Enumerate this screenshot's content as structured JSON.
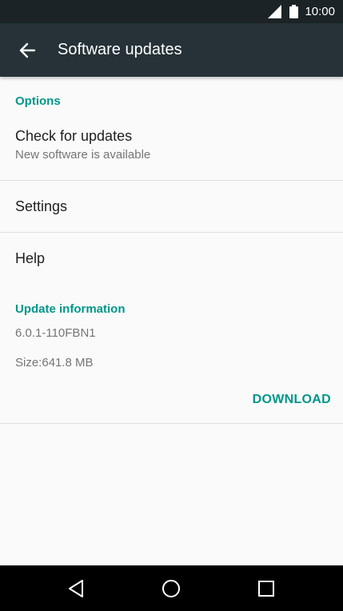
{
  "status_bar": {
    "time": "10:00",
    "icons": [
      "signal-icon",
      "battery-icon"
    ]
  },
  "app_bar": {
    "title": "Software updates",
    "back_icon": "arrow-left-icon"
  },
  "sections": {
    "options_header": "Options",
    "check_updates": {
      "title": "Check for updates",
      "subtitle": "New software is available"
    },
    "settings": {
      "title": "Settings"
    },
    "help": {
      "title": "Help"
    },
    "update_info_header": "Update information",
    "version": "6.0.1-110FBN1",
    "size": "Size:641.8 MB",
    "download_label": "DOWNLOAD"
  },
  "nav_bar": {
    "icons": [
      "back-triangle-icon",
      "home-circle-icon",
      "recents-square-icon"
    ]
  },
  "colors": {
    "accent": "#00968a",
    "app_bar": "#263238",
    "status_bar": "#1c2326",
    "background": "#fafafa"
  }
}
